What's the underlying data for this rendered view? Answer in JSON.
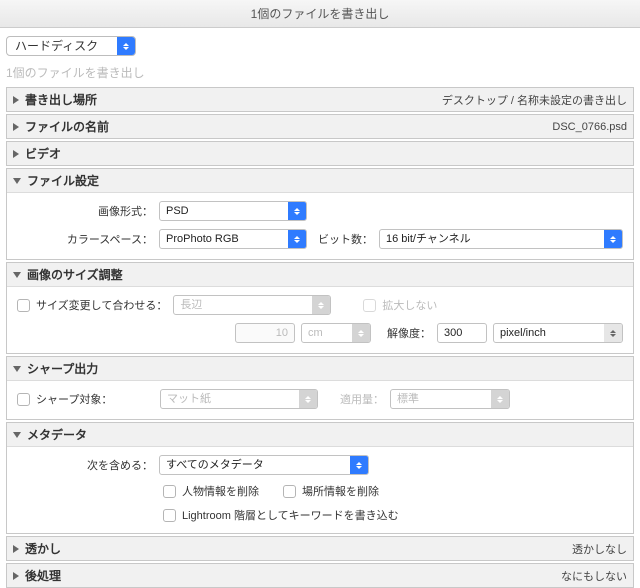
{
  "title": "1個のファイルを書き出し",
  "destination": {
    "value": "ハードディスク"
  },
  "status": "1個のファイルを書き出し",
  "panels": {
    "location": {
      "title": "書き出し場所",
      "summary": "デスクトップ / 名称未設定の書き出し"
    },
    "filename": {
      "title": "ファイルの名前",
      "summary": "DSC_0766.psd"
    },
    "video": {
      "title": "ビデオ"
    },
    "filesettings": {
      "title": "ファイル設定",
      "format_label": "画像形式：",
      "format_value": "PSD",
      "colorspace_label": "カラースペース：",
      "colorspace_value": "ProPhoto RGB",
      "bitdepth_label": "ビット数：",
      "bitdepth_value": "16 bit/チャンネル"
    },
    "sizing": {
      "title": "画像のサイズ調整",
      "resize_label": "サイズ変更して合わせる：",
      "resize_method": "長辺",
      "noenlarge_label": "拡大しない",
      "size_value": "10",
      "unit_value": "cm",
      "resolution_label": "解像度：",
      "resolution_value": "300",
      "resolution_unit": "pixel/inch"
    },
    "sharpen": {
      "title": "シャープ出力",
      "for_label": "シャープ対象：",
      "for_value": "マット紙",
      "amount_label": "適用量：",
      "amount_value": "標準"
    },
    "metadata": {
      "title": "メタデータ",
      "include_label": "次を含める：",
      "include_value": "すべてのメタデータ",
      "remove_person": "人物情報を削除",
      "remove_location": "場所情報を削除",
      "write_hierarchy": "Lightroom 階層としてキーワードを書き込む"
    },
    "watermark": {
      "title": "透かし",
      "summary": "透かしなし"
    },
    "post": {
      "title": "後処理",
      "summary": "なにもしない"
    }
  }
}
